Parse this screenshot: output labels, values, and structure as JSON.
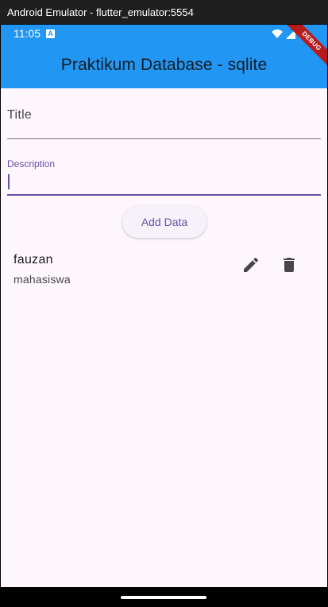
{
  "window": {
    "title": "Android Emulator - flutter_emulator:5554"
  },
  "status_bar": {
    "time": "11:05",
    "notification_icon": "A",
    "color": "#2196f3"
  },
  "app_bar": {
    "title": "Praktikum Database - sqlite",
    "color": "#2196f3"
  },
  "debug_banner": {
    "text": "DEBUG"
  },
  "form": {
    "title_field": {
      "label": "Title",
      "value": ""
    },
    "description_field": {
      "label": "Description",
      "value": ""
    },
    "add_button_label": "Add Data"
  },
  "items": [
    {
      "title": "fauzan",
      "subtitle": "mahasiswa",
      "edit_icon": "pencil-icon",
      "delete_icon": "trash-icon"
    }
  ],
  "colors": {
    "accent": "#6750a4",
    "background": "#fdf6fd",
    "debug": "#b71c1c"
  }
}
